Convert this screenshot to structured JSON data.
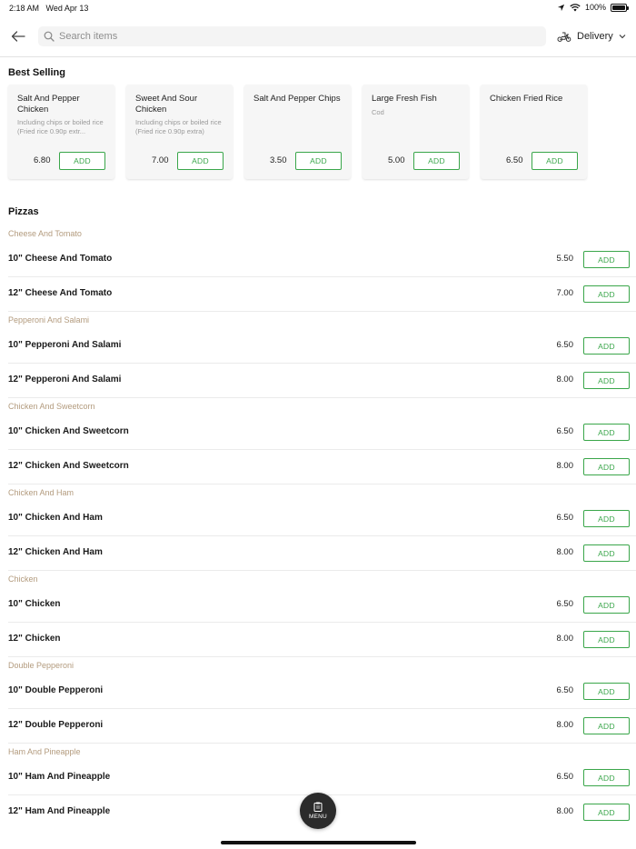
{
  "status_bar": {
    "time": "2:18 AM",
    "date": "Wed Apr 13",
    "battery": "100%",
    "battery_level": 1.0
  },
  "header": {
    "search_placeholder": "Search items",
    "delivery_label": "Delivery"
  },
  "best_selling": {
    "title": "Best Selling",
    "add_label": "ADD",
    "items": [
      {
        "name": "Salt And Pepper Chicken",
        "desc": "Including chips or boiled rice (Fried rice 0.90p extr...",
        "price": "6.80"
      },
      {
        "name": "Sweet And Sour Chicken",
        "desc": "Including chips or boiled rice (Fried rice 0.90p extra)",
        "price": "7.00"
      },
      {
        "name": "Salt And Pepper Chips",
        "desc": "",
        "price": "3.50"
      },
      {
        "name": "Large Fresh Fish",
        "desc": "Cod",
        "price": "5.00"
      },
      {
        "name": "Chicken Fried Rice",
        "desc": "",
        "price": "6.50"
      }
    ]
  },
  "pizzas": {
    "title": "Pizzas",
    "add_label": "ADD",
    "categories": [
      {
        "name": "Cheese And Tomato",
        "items": [
          {
            "name": "10\" Cheese And Tomato",
            "price": "5.50"
          },
          {
            "name": "12\" Cheese And Tomato",
            "price": "7.00"
          }
        ]
      },
      {
        "name": "Pepperoni And Salami",
        "items": [
          {
            "name": "10\" Pepperoni And Salami",
            "price": "6.50"
          },
          {
            "name": "12\" Pepperoni And Salami",
            "price": "8.00"
          }
        ]
      },
      {
        "name": "Chicken And Sweetcorn",
        "items": [
          {
            "name": "10\" Chicken And Sweetcorn",
            "price": "6.50"
          },
          {
            "name": "12\" Chicken And Sweetcorn",
            "price": "8.00"
          }
        ]
      },
      {
        "name": "Chicken And Ham",
        "items": [
          {
            "name": "10\" Chicken And Ham",
            "price": "6.50"
          },
          {
            "name": "12\" Chicken And Ham",
            "price": "8.00"
          }
        ]
      },
      {
        "name": "Chicken",
        "items": [
          {
            "name": "10\" Chicken",
            "price": "6.50"
          },
          {
            "name": "12\" Chicken",
            "price": "8.00"
          }
        ]
      },
      {
        "name": "Double Pepperoni",
        "items": [
          {
            "name": "10\" Double Pepperoni",
            "price": "6.50"
          },
          {
            "name": "12\" Double Pepperoni",
            "price": "8.00"
          }
        ]
      },
      {
        "name": "Ham And Pineapple",
        "items": [
          {
            "name": "10\" Ham And Pineapple",
            "price": "6.50"
          },
          {
            "name": "12\" Ham And Pineapple",
            "price": "8.00"
          }
        ]
      }
    ]
  },
  "menu_button": {
    "label": "MENU"
  },
  "colors": {
    "accent_green": "#3aa64a",
    "category_tan": "#b39b7e",
    "fab_dark": "#2b2b2b"
  },
  "icons": [
    "back-arrow-icon",
    "search-icon",
    "scooter-icon",
    "chevron-down-icon",
    "location-arrow-icon",
    "wifi-icon",
    "battery-icon",
    "menu-clipboard-icon"
  ]
}
